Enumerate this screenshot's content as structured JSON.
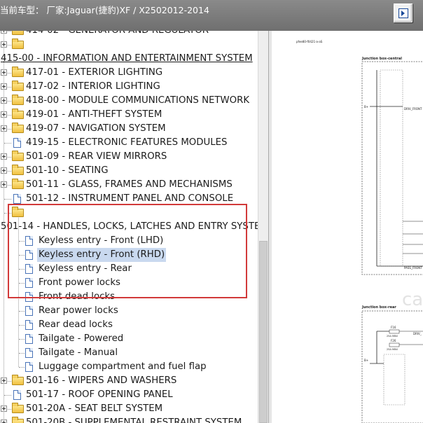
{
  "window": {
    "title": "当前车型： 厂家:Jaguar(捷豹)XF / X2502012-2014",
    "action_button_icon": "play-box-icon"
  },
  "tree": {
    "rows": [
      {
        "label": "414-02 - GENERATOR AND REGULATOR",
        "type": "folder",
        "expander": true
      },
      {
        "label": "",
        "type": "folder",
        "expander": true
      },
      {
        "label": "415-00 - INFORMATION AND ENTERTAINMENT SYSTEM",
        "type": "text",
        "underline": true
      },
      {
        "label": "417-01 - EXTERIOR LIGHTING",
        "type": "folder",
        "expander": true
      },
      {
        "label": "417-02 - INTERIOR LIGHTING",
        "type": "folder",
        "expander": true
      },
      {
        "label": "418-00 - MODULE COMMUNICATIONS NETWORK",
        "type": "folder",
        "expander": true
      },
      {
        "label": "419-01 - ANTI-THEFT SYSTEM",
        "type": "folder",
        "expander": true
      },
      {
        "label": "419-07 - NAVIGATION SYSTEM",
        "type": "folder",
        "expander": true
      },
      {
        "label": "419-15 - ELECTRONIC FEATURES MODULES",
        "type": "doc",
        "expander": false
      },
      {
        "label": "501-09 - REAR VIEW MIRRORS",
        "type": "folder",
        "expander": true
      },
      {
        "label": "501-10 - SEATING",
        "type": "folder",
        "expander": true
      },
      {
        "label": "501-11 - GLASS, FRAMES AND MECHANISMS",
        "type": "folder",
        "expander": true
      },
      {
        "label": "501-12 - INSTRUMENT PANEL AND CONSOLE",
        "type": "doc",
        "expander": false
      },
      {
        "label": "",
        "type": "folder-open",
        "expander": false
      },
      {
        "label": "501-14 - HANDLES, LOCKS, LATCHES AND ENTRY SYSTEMS",
        "type": "text"
      },
      {
        "label": "Keyless entry - Front (LHD)",
        "type": "child-doc"
      },
      {
        "label": "Keyless entry - Front (RHD)",
        "type": "child-doc",
        "selected": true
      },
      {
        "label": "Keyless entry - Rear",
        "type": "child-doc"
      },
      {
        "label": "Front power locks",
        "type": "child-doc"
      },
      {
        "label": "Front dead locks",
        "type": "child-doc"
      },
      {
        "label": "Rear power locks",
        "type": "child-doc"
      },
      {
        "label": "Rear dead locks",
        "type": "child-doc"
      },
      {
        "label": "Tailgate - Powered",
        "type": "child-doc"
      },
      {
        "label": "Tailgate - Manual",
        "type": "child-doc"
      },
      {
        "label": "Luggage compartment and fuel flap",
        "type": "child-doc"
      },
      {
        "label": "501-16 - WIPERS AND WASHERS",
        "type": "folder",
        "expander": true
      },
      {
        "label": "501-17 - ROOF OPENING PANEL",
        "type": "doc",
        "expander": false
      },
      {
        "label": "501-20A - SEAT BELT SYSTEM",
        "type": "folder",
        "expander": true
      },
      {
        "label": "501-20B - SUPPLEMENTAL RESTRAINT SYSTEM",
        "type": "folder",
        "expander": true
      }
    ]
  },
  "diagram": {
    "header_code": "pfee80-f0421-a-aS",
    "box1_title": "Junction box-central",
    "box1_signal": "DRIV_FRONT",
    "box1_pin": "B+",
    "box1_bottom_label": "PASS_FRONT",
    "box2_title": "Junction box-rear",
    "box2_fuse1": "F16",
    "box2_fuse1_rating": "25A MINI",
    "box2_fuse2": "F26",
    "box2_fuse2_rating": "25A MINI",
    "box2_signal": "DRIV_",
    "box2_pin": "B+",
    "watermark": "ca"
  }
}
